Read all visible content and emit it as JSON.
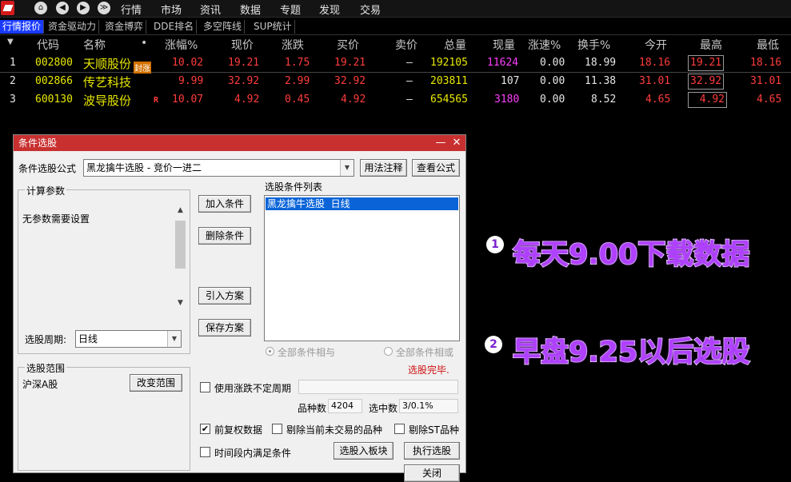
{
  "topbar": {
    "nav_icons": [
      "home-icon",
      "back-icon",
      "forward-icon",
      "dropdown-icon"
    ],
    "menus": [
      "行情",
      "市场",
      "资讯",
      "数据",
      "专题",
      "发现",
      "交易"
    ]
  },
  "tabs": [
    "行情报价",
    "资金驱动力",
    "资金博弈",
    "DDE排名",
    "多空阵线",
    "SUP统计"
  ],
  "table": {
    "headers": [
      "代码",
      "名称",
      "•",
      "涨幅%",
      "现价",
      "涨跌",
      "买价",
      "卖价",
      "总量",
      "现量",
      "涨速%",
      "换手%",
      "今开",
      "最高",
      "最低"
    ],
    "rows": [
      {
        "idx": "1",
        "code": "002800",
        "name": "天顺股份",
        "tag": "封涨",
        "chg_pct": "10.02",
        "price": "19.21",
        "chg": "1.75",
        "bid": "19.21",
        "ask": "—",
        "vol": "192105",
        "cur_vol": "11624",
        "speed": "0.00",
        "turnover": "18.99",
        "open": "18.16",
        "high": "19.21",
        "low": "18.16"
      },
      {
        "idx": "2",
        "code": "002866",
        "name": "传艺科技",
        "tag": "",
        "chg_pct": "9.99",
        "price": "32.92",
        "chg": "2.99",
        "bid": "32.92",
        "ask": "—",
        "vol": "203811",
        "cur_vol": "107",
        "speed": "0.00",
        "turnover": "11.38",
        "open": "31.01",
        "high": "32.92",
        "low": "31.01"
      },
      {
        "idx": "3",
        "code": "600130",
        "name": "波导股份",
        "tag": "R",
        "chg_pct": "10.07",
        "price": "4.92",
        "chg": "0.45",
        "bid": "4.92",
        "ask": "—",
        "vol": "654565",
        "cur_vol": "3180",
        "speed": "0.00",
        "turnover": "8.52",
        "open": "4.65",
        "high": "4.92",
        "low": "4.65"
      }
    ]
  },
  "dialog": {
    "title": "条件选股",
    "formula_label": "条件选股公式",
    "formula_value": "黑龙擒牛选股 - 竞价一进二",
    "usage_btn": "用法注释",
    "view_formula_btn": "查看公式",
    "params_group": "计算参数",
    "params_text": "无参数需要设置",
    "period_label": "选股周期:",
    "period_value": "日线",
    "add_btn": "加入条件",
    "delete_btn": "删除条件",
    "import_btn": "引入方案",
    "save_btn": "保存方案",
    "cond_list_label": "选股条件列表",
    "cond_item": "黑龙擒牛选股  日线",
    "radio_and": "全部条件相与",
    "radio_or": "全部条件相或",
    "status": "选股完毕.",
    "range_group": "选股范围",
    "range_value": "沪深A股",
    "change_range_btn": "改变范围",
    "use_irregular": "使用涨跌不定周期",
    "count_label": "品种数",
    "count_value": "4204",
    "selected_label": "选中数",
    "selected_value": "3/0.1%",
    "chk_fq": "前复权数据",
    "chk_exclude_untraded": "剔除当前未交易的品种",
    "chk_exclude_st": "剔除ST品种",
    "chk_period": "时间段内满足条件",
    "to_block_btn": "选股入板块",
    "run_btn": "执行选股",
    "close_btn": "关闭"
  },
  "overlay": {
    "step1_num": "1",
    "step1": "每天9.00下载数据",
    "step2_num": "2",
    "step2": "早盘9.25以后选股"
  },
  "colors": {
    "up": "#ff3c3c",
    "tab_active": "#1a3bff",
    "title_bar": "#c83030",
    "overlay_text": "#b040ff"
  }
}
